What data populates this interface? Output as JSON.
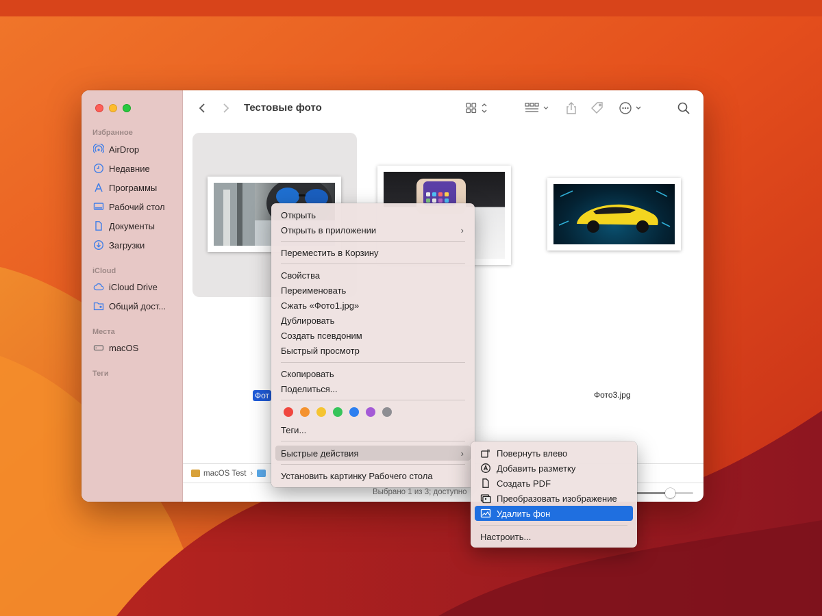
{
  "window": {
    "title": "Тестовые фото",
    "traffic_lights": [
      "close",
      "minimize",
      "zoom"
    ]
  },
  "sidebar": {
    "sections": [
      {
        "label": "Избранное",
        "items": [
          {
            "label": "AirDrop",
            "icon": "airdrop-icon"
          },
          {
            "label": "Недавние",
            "icon": "clock-icon"
          },
          {
            "label": "Программы",
            "icon": "apps-icon"
          },
          {
            "label": "Рабочий стол",
            "icon": "desktop-icon"
          },
          {
            "label": "Документы",
            "icon": "document-icon"
          },
          {
            "label": "Загрузки",
            "icon": "download-icon"
          }
        ]
      },
      {
        "label": "iCloud",
        "items": [
          {
            "label": "iCloud Drive",
            "icon": "cloud-icon"
          },
          {
            "label": "Общий дост...",
            "icon": "shared-folder-icon"
          }
        ]
      },
      {
        "label": "Места",
        "items": [
          {
            "label": "macOS",
            "icon": "disk-icon"
          }
        ]
      },
      {
        "label": "Теги",
        "items": []
      }
    ]
  },
  "files": [
    {
      "label": "Фот",
      "selected": true
    },
    {
      "label": "",
      "selected": false
    },
    {
      "label": "Фото3.jpg",
      "selected": false
    }
  ],
  "pathbar": {
    "items": [
      "macOS Test",
      ""
    ]
  },
  "status": {
    "text": "Выбрано 1 из 3; доступно",
    "zoom_fraction": 0.6
  },
  "context_menu": {
    "items": [
      {
        "label": "Открыть"
      },
      {
        "label": "Открыть в приложении",
        "submenu": true
      },
      {
        "label": "Переместить в Корзину"
      },
      {
        "label": "Свойства"
      },
      {
        "label": "Переименовать"
      },
      {
        "label": "Сжать «Фото1.jpg»"
      },
      {
        "label": "Дублировать"
      },
      {
        "label": "Создать псевдоним"
      },
      {
        "label": "Быстрый просмотр"
      },
      {
        "label": "Скопировать"
      },
      {
        "label": "Поделиться..."
      },
      {
        "label": "Теги..."
      },
      {
        "label": "Быстрые действия",
        "submenu": true,
        "highlighted": true
      },
      {
        "label": "Установить картинку Рабочего стола"
      }
    ],
    "tag_colors": [
      "#f0473f",
      "#f4922f",
      "#f5c431",
      "#36c45a",
      "#2d7ff0",
      "#a45ad6",
      "#8e8e93"
    ],
    "arrow": "›"
  },
  "quick_actions_menu": {
    "items": [
      {
        "label": "Повернуть влево",
        "icon": "rotate-left-icon"
      },
      {
        "label": "Добавить разметку",
        "icon": "markup-icon"
      },
      {
        "label": "Создать PDF",
        "icon": "pdf-icon"
      },
      {
        "label": "Преобразовать изображение",
        "icon": "convert-image-icon"
      },
      {
        "label": "Удалить фон",
        "icon": "remove-background-icon",
        "active": true
      },
      {
        "label": "Настроить..."
      }
    ]
  },
  "colors": {
    "accent": "#1f6fe0",
    "sidebar": "#e7c8c6"
  }
}
